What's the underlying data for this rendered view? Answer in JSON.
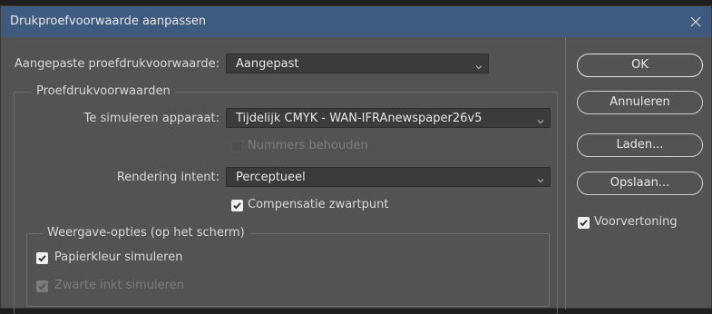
{
  "dialog": {
    "title": "Drukproefvoorwaarde aanpassen"
  },
  "custom_condition": {
    "label": "Aangepaste proefdrukvoorwaarde:",
    "value": "Aangepast"
  },
  "proof_conditions": {
    "legend": "Proefdrukvoorwaarden",
    "device_label": "Te simuleren apparaat:",
    "device_value": "Tijdelijk CMYK - WAN-IFRAnewspaper26v5",
    "preserve_numbers": {
      "label": "Nummers behouden",
      "checked": false,
      "enabled": false
    },
    "rendering_label": "Rendering intent:",
    "rendering_value": "Perceptueel",
    "black_point": {
      "label": "Compensatie zwartpunt",
      "checked": true
    }
  },
  "display_options": {
    "legend": "Weergave-opties (op het scherm)",
    "paper_color": {
      "label": "Papierkleur simuleren",
      "checked": true
    },
    "black_ink": {
      "label": "Zwarte inkt simuleren",
      "checked": true,
      "enabled": false
    }
  },
  "buttons": {
    "ok": "OK",
    "cancel": "Annuleren",
    "load": "Laden...",
    "save": "Opslaan..."
  },
  "preview": {
    "label": "Voorvertoning",
    "checked": true
  },
  "icons": {
    "close": "close-icon",
    "dropdown": "chevron-down-icon",
    "check": "checkmark-icon"
  },
  "colors": {
    "titlebar": "#3e5a7f",
    "panel": "#535353",
    "field": "#3b3b3b"
  }
}
